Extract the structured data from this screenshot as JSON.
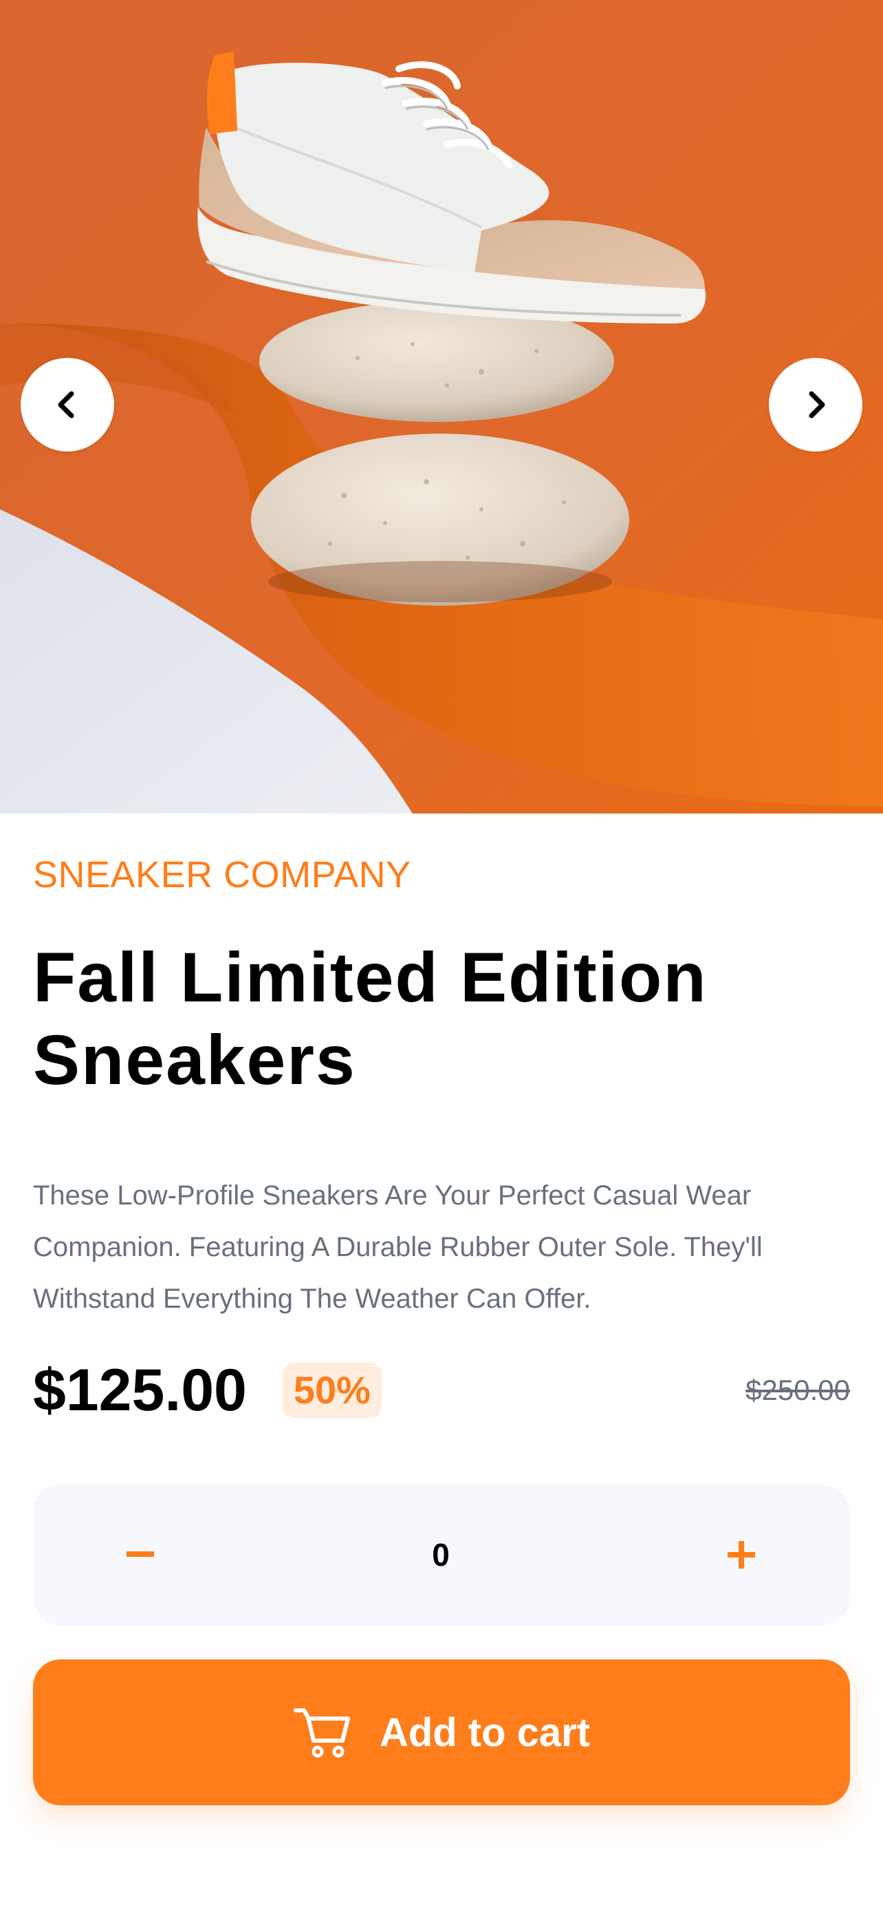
{
  "carousel": {
    "image_description": "product-image-sneaker-on-stones",
    "prev_icon": "chevron-left-icon",
    "next_icon": "chevron-right-icon"
  },
  "product": {
    "brand": "SNEAKER COMPANY",
    "title": "Fall Limited Edition Sneakers",
    "description": "These Low-Profile Sneakers Are Your Perfect Casual Wear Companion. Featuring A Durable Rubber Outer Sole. They'll Withstand Everything The Weather Can Offer.",
    "price": "$125.00",
    "discount": "50%",
    "original_price": "$250.00"
  },
  "quantity": {
    "decrement_icon": "minus-icon",
    "value": "0",
    "increment_icon": "plus-icon"
  },
  "cart_button": {
    "icon": "cart-icon",
    "label": "Add to cart"
  },
  "colors": {
    "accent": "#ff7d1a",
    "accent_pale": "#ffede0",
    "text_dark": "#000000",
    "text_muted": "#68707d",
    "qty_bg": "#f6f8fd"
  }
}
